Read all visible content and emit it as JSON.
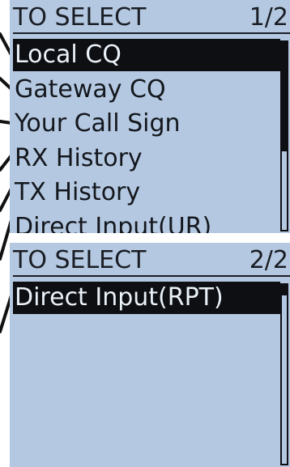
{
  "screen1": {
    "title": "TO SELECT",
    "page": "1/2",
    "items": [
      {
        "label": "Local CQ",
        "selected": true
      },
      {
        "label": "Gateway CQ",
        "selected": false
      },
      {
        "label": "Your Call Sign",
        "selected": false
      },
      {
        "label": "RX History",
        "selected": false
      },
      {
        "label": "TX History",
        "selected": false
      },
      {
        "label": "Direct Input(UR)",
        "selected": false
      }
    ],
    "scroll_position": 0.58
  },
  "screen2": {
    "title": "TO SELECT",
    "page": "2/2",
    "items": [
      {
        "label": "Direct Input(RPT)",
        "selected": true
      }
    ],
    "scroll_position": 0.06
  },
  "colors": {
    "lcd_background": "#b4c9e1",
    "text": "#14171d",
    "selection": "#0e0f12",
    "selection_text": "#eaf1f8"
  }
}
